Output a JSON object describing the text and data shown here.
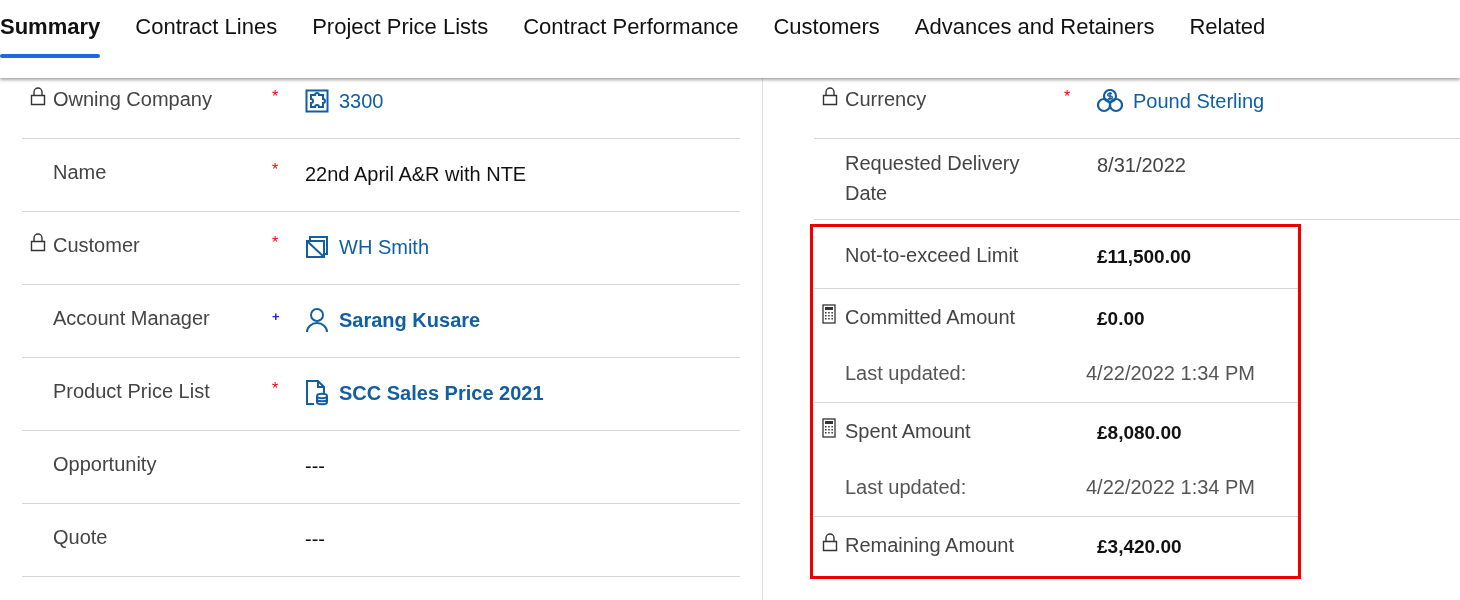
{
  "tabs": [
    {
      "label": "Summary",
      "selected": true
    },
    {
      "label": "Contract Lines",
      "selected": false
    },
    {
      "label": "Project Price Lists",
      "selected": false
    },
    {
      "label": "Contract Performance",
      "selected": false
    },
    {
      "label": "Customers",
      "selected": false
    },
    {
      "label": "Advances and Retainers",
      "selected": false
    },
    {
      "label": "Related",
      "selected": false
    }
  ],
  "left_column": {
    "fields": [
      {
        "label": "Owning Company",
        "locked": true,
        "calculated": false,
        "required_mark": "*",
        "recommended": false,
        "kind": "link",
        "value": "3300",
        "value_icon": {
          "kind": "puzzle"
        }
      },
      {
        "label": "Name",
        "locked": false,
        "calculated": false,
        "required_mark": "*",
        "recommended": false,
        "kind": "text",
        "value": "22nd April A&R with NTE"
      },
      {
        "label": "Customer",
        "locked": true,
        "calculated": false,
        "required_mark": "*",
        "recommended": false,
        "kind": "link",
        "value": "WH Smith",
        "value_icon": {
          "kind": "stack"
        }
      },
      {
        "label": "Account Manager",
        "locked": false,
        "calculated": false,
        "required_mark": "+",
        "recommended": true,
        "kind": "boldlink",
        "value": "Sarang Kusare",
        "value_icon": {
          "kind": "person"
        }
      },
      {
        "label": "Product Price List",
        "locked": false,
        "calculated": false,
        "required_mark": "*",
        "recommended": false,
        "kind": "boldlink",
        "value": "SCC Sales Price 2021",
        "value_icon": {
          "kind": "document"
        }
      },
      {
        "label": "Opportunity",
        "locked": false,
        "calculated": false,
        "kind": "text",
        "value": "---"
      },
      {
        "label": "Quote",
        "locked": false,
        "calculated": false,
        "kind": "text",
        "value": "---"
      }
    ]
  },
  "right_column": {
    "fields": [
      {
        "label": "Currency",
        "locked": true,
        "calculated": false,
        "required_mark": "*",
        "recommended": false,
        "kind": "link",
        "value": "Pound Sterling",
        "value_icon": {
          "kind": "coins"
        }
      },
      {
        "label": "Requested Delivery Date",
        "locked": false,
        "calculated": false,
        "kind": "plain",
        "value": "8/31/2022"
      }
    ],
    "highlighted_fields": [
      {
        "label": "Not-to-exceed Limit",
        "locked": false,
        "calculated": false,
        "kind": "amount",
        "value": "£11,500.00"
      },
      {
        "label": "Committed Amount",
        "locked": false,
        "calculated": true,
        "kind": "amount",
        "value": "£0.00",
        "note": {
          "label": "Last updated:",
          "value": "4/22/2022 1:34 PM"
        }
      },
      {
        "label": "Spent Amount",
        "locked": false,
        "calculated": true,
        "kind": "amount",
        "value": "£8,080.00",
        "note": {
          "label": "Last updated:",
          "value": "4/22/2022 1:34 PM"
        }
      },
      {
        "label": "Remaining Amount",
        "locked": true,
        "calculated": false,
        "kind": "amount",
        "value": "£3,420.00"
      }
    ]
  }
}
